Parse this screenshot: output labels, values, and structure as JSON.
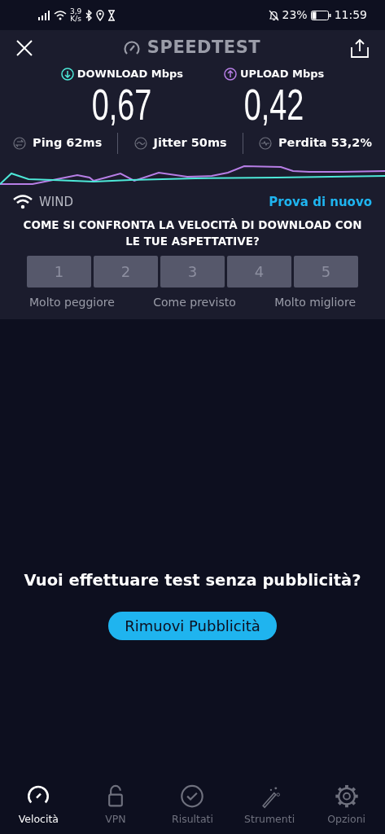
{
  "status_bar": {
    "speed_value": "3,9",
    "speed_unit": "K/s",
    "battery": "23%",
    "time": "11:59"
  },
  "header": {
    "title": "SPEEDTEST"
  },
  "results": [
    {
      "kind": "download",
      "label": "DOWNLOAD Mbps",
      "value": "0,67",
      "color": "#4de8d8"
    },
    {
      "kind": "upload",
      "label": "UPLOAD Mbps",
      "value": "0,42",
      "color": "#b77ee6"
    }
  ],
  "metrics": [
    {
      "kind": "ping",
      "label": "Ping",
      "value": "62ms"
    },
    {
      "kind": "jitter",
      "label": "Jitter",
      "value": "50ms"
    },
    {
      "kind": "loss",
      "label": "Perdita",
      "value": "53,2%"
    }
  ],
  "network": {
    "name": "WIND",
    "retry": "Prova di nuovo"
  },
  "survey": {
    "question": "COME SI CONFRONTA LA VELOCITÀ DI DOWNLOAD CON LE TUE ASPETTATIVE?",
    "options": [
      {
        "label": "1",
        "selected": false
      },
      {
        "label": "2",
        "selected": false
      },
      {
        "label": "3",
        "selected": false
      },
      {
        "label": "4",
        "selected": false
      },
      {
        "label": "5",
        "selected": false
      }
    ],
    "scale_labels": [
      "Molto peggiore",
      "Come previsto",
      "Molto migliore"
    ]
  },
  "promo": {
    "text": "Vuoi effettuare test senza pubblicità?",
    "button": "Rimuovi Pubblicità"
  },
  "tabs": [
    {
      "kind": "speed",
      "label": "Velocità",
      "selected": true
    },
    {
      "kind": "vpn",
      "label": "VPN",
      "selected": false
    },
    {
      "kind": "results",
      "label": "Risultati",
      "selected": false
    },
    {
      "kind": "tools",
      "label": "Strumenti",
      "selected": false
    },
    {
      "kind": "settings",
      "label": "Opzioni",
      "selected": false
    }
  ]
}
